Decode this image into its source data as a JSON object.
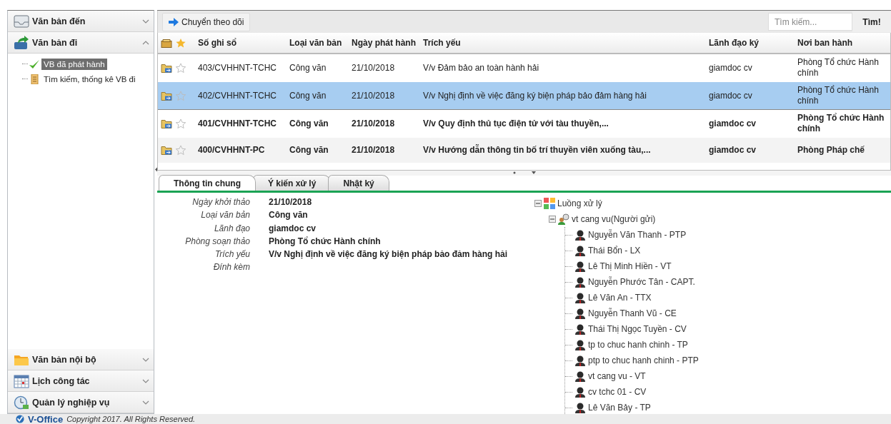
{
  "sidebar": {
    "sections": [
      {
        "label": "Văn bản đến",
        "expanded": false
      },
      {
        "label": "Văn bản đi",
        "expanded": true,
        "items": [
          {
            "label": "VB đã phát hành",
            "selected": true
          },
          {
            "label": "Tìm kiếm, thống kê VB đi",
            "selected": false
          }
        ]
      }
    ],
    "bottom_sections": [
      {
        "label": "Văn bản nội bộ",
        "expanded": false
      },
      {
        "label": "Lịch công tác",
        "expanded": false
      },
      {
        "label": "Quản lý nghiệp vụ",
        "expanded": false
      }
    ]
  },
  "toolbar": {
    "button": "Chuyển theo dõi",
    "search": {
      "placeholder": "Tìm kiếm..."
    },
    "search_button": "Tìm!"
  },
  "table": {
    "columns": [
      "Số ghi sổ",
      "Loại văn bản",
      "Ngày phát hành",
      "Trích yếu",
      "Lãnh đạo ký",
      "Nơi ban hành"
    ],
    "rows": [
      {
        "cells": [
          "403/CVHHNT-TCHC",
          "Công văn",
          "21/10/2018",
          "V/v Đảm bảo an toàn hành hải",
          "giamdoc cv",
          "Phòng Tổ chức Hành chính"
        ],
        "selected": false,
        "unread": false,
        "starred": false
      },
      {
        "cells": [
          "402/CVHHNT-TCHC",
          "Công văn",
          "21/10/2018",
          "V/v Nghị định về việc đăng ký biện pháp bảo đảm hàng hải",
          "giamdoc cv",
          "Phòng Tổ chức Hành chính"
        ],
        "selected": true,
        "unread": false,
        "starred": false
      },
      {
        "cells": [
          "401/CVHHNT-TCHC",
          "Công văn",
          "21/10/2018",
          "V/v Quy định thủ tục điện tử với tàu thuyền,...",
          "giamdoc cv",
          "Phòng Tổ chức Hành chính"
        ],
        "selected": false,
        "unread": true,
        "starred": false
      },
      {
        "cells": [
          "400/CVHHNT-PC",
          "Công văn",
          "21/10/2018",
          "V/v Hướng dẫn thông tin bố trí thuyền viên xuống tàu,...",
          "giamdoc cv",
          "Phòng Pháp chế"
        ],
        "selected": false,
        "unread": true,
        "starred": false
      }
    ]
  },
  "detail_tabs": [
    {
      "label": "Thông tin chung",
      "selected": true
    },
    {
      "label": "Ý kiến xử lý",
      "selected": false
    },
    {
      "label": "Nhật ký",
      "selected": false
    }
  ],
  "details": [
    {
      "label": "Ngày khởi thảo",
      "value": "21/10/2018"
    },
    {
      "label": "Loại văn bản",
      "value": "Công văn"
    },
    {
      "label": "Lãnh đạo",
      "value": "giamdoc cv"
    },
    {
      "label": "Phòng soạn thảo",
      "value": "Phòng Tổ chức Hành chính"
    },
    {
      "label": "Trích yếu",
      "value": "V/v Nghị định về việc đăng ký biện pháp bảo đảm hàng hải"
    },
    {
      "label": "Đính kèm"
    }
  ],
  "flow_tree": {
    "label": "Luồng xử lý",
    "expanded": true,
    "children": [
      {
        "label": "vt cang vu(Người gửi)",
        "expanded": true,
        "children": [
          {
            "label": "Nguyễn Văn Thanh - PTP"
          },
          {
            "label": "Thái Bổn - LX"
          },
          {
            "label": "Lê Thị Minh Hiền - VT"
          },
          {
            "label": "Nguyễn Phước Tân - CAPT."
          },
          {
            "label": "Lê Văn An - TTX"
          },
          {
            "label": "Nguyễn Thanh Vũ - CE"
          },
          {
            "label": "Thái Thị Ngọc Tuyền - CV"
          },
          {
            "label": "tp to chuc hanh chinh - TP"
          },
          {
            "label": "ptp to chuc hanh chinh - PTP"
          },
          {
            "label": "vt cang vu - VT"
          },
          {
            "label": "cv tchc 01 - CV"
          },
          {
            "label": "Lê Văn Bảy - TP"
          }
        ]
      }
    ]
  },
  "footer": {
    "logo": "V-Office",
    "copyright": "Copyright 2017. All Rights Reserved."
  }
}
